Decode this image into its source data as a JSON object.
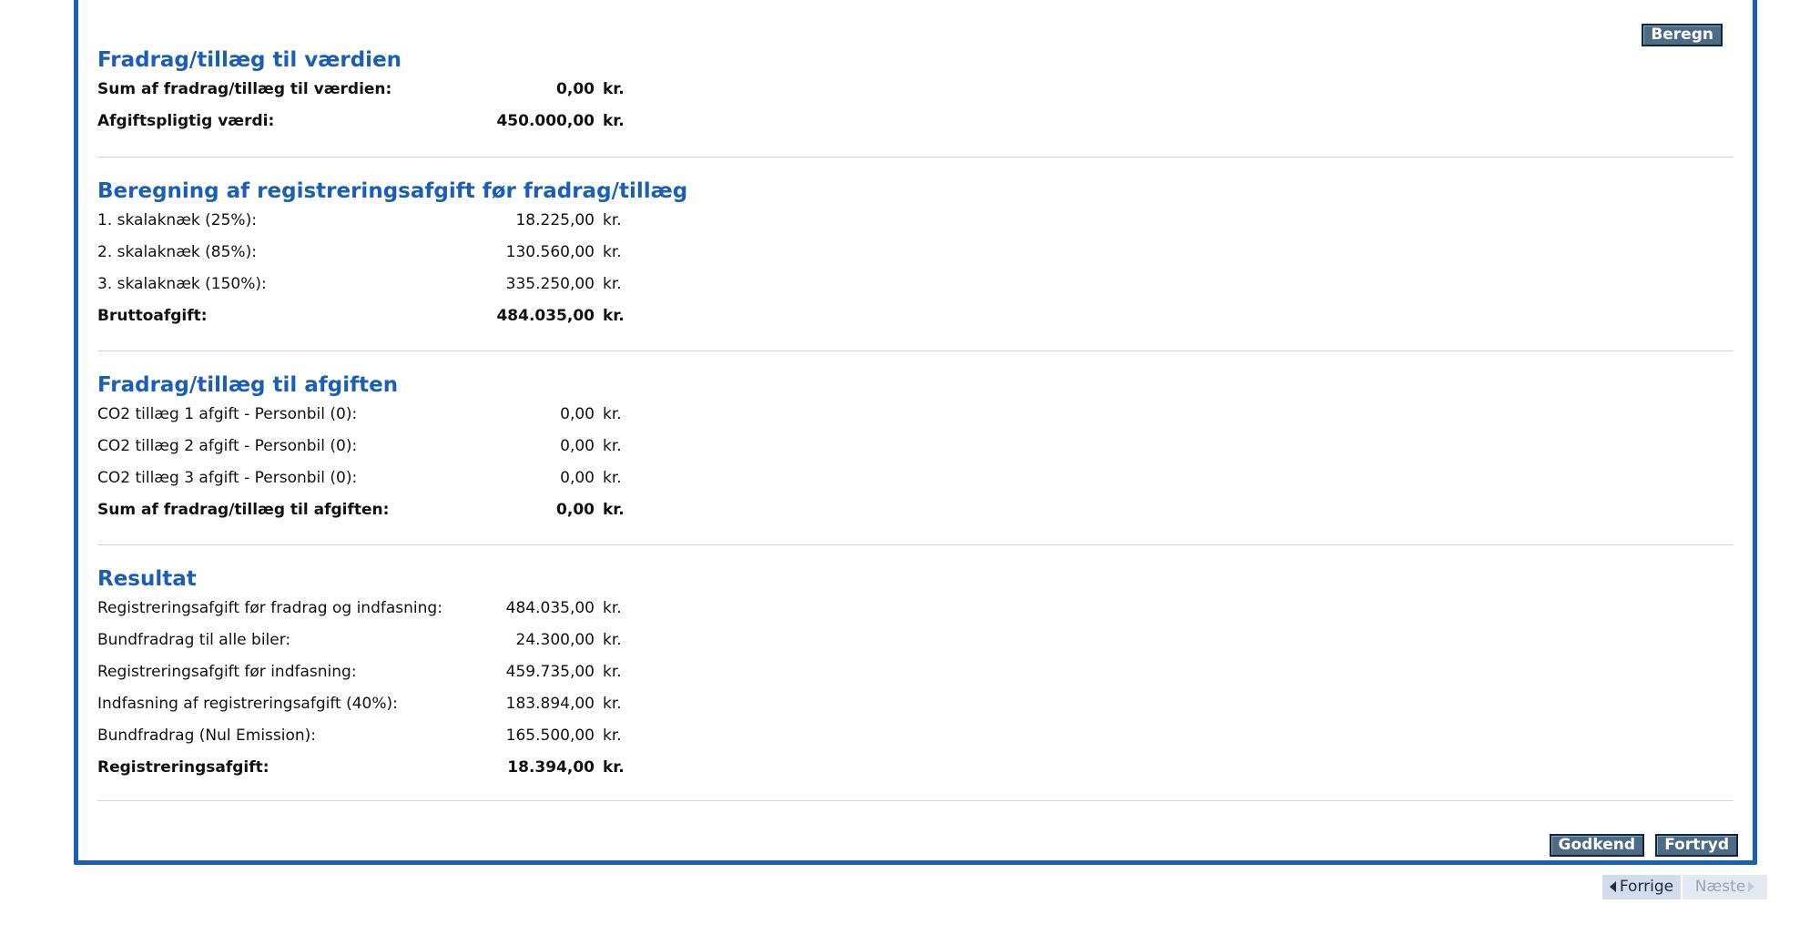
{
  "colors": {
    "accent": "#1a5fb4",
    "button_bg": "#4e6b85",
    "divider": "#d4d4d4"
  },
  "buttons": {
    "beregn": "Beregn",
    "godkend": "Godkend",
    "fortryd": "Fortryd"
  },
  "pager": {
    "prev": "Forrige",
    "next": "Næste",
    "prev_icon": "triangle-left-icon",
    "next_icon": "triangle-right-icon"
  },
  "sections": [
    {
      "title": "Fradrag/tillæg til værdien",
      "rows": [
        {
          "label": "Sum af fradrag/tillæg til værdien:",
          "value": "0,00",
          "unit": "kr.",
          "bold": true
        },
        {
          "label": "Afgiftspligtig værdi:",
          "value": "450.000,00",
          "unit": "kr.",
          "bold": true
        }
      ]
    },
    {
      "title": "Beregning af registreringsafgift før fradrag/tillæg",
      "rows": [
        {
          "label": "1. skalaknæk (25%):",
          "value": "18.225,00",
          "unit": "kr.",
          "bold": false
        },
        {
          "label": "2. skalaknæk (85%):",
          "value": "130.560,00",
          "unit": "kr.",
          "bold": false
        },
        {
          "label": "3. skalaknæk (150%):",
          "value": "335.250,00",
          "unit": "kr.",
          "bold": false
        },
        {
          "label": "Bruttoafgift:",
          "value": "484.035,00",
          "unit": "kr.",
          "bold": true
        }
      ]
    },
    {
      "title": "Fradrag/tillæg til afgiften",
      "rows": [
        {
          "label": "CO2 tillæg 1 afgift - Personbil (0):",
          "value": "0,00",
          "unit": "kr.",
          "bold": false
        },
        {
          "label": "CO2 tillæg 2 afgift - Personbil (0):",
          "value": "0,00",
          "unit": "kr.",
          "bold": false
        },
        {
          "label": "CO2 tillæg 3 afgift - Personbil (0):",
          "value": "0,00",
          "unit": "kr.",
          "bold": false
        },
        {
          "label": "Sum af fradrag/tillæg til afgiften:",
          "value": "0,00",
          "unit": "kr.",
          "bold": true
        }
      ]
    },
    {
      "title": "Resultat",
      "rows": [
        {
          "label": "Registreringsafgift før fradrag og indfasning:",
          "value": "484.035,00",
          "unit": "kr.",
          "bold": false
        },
        {
          "label": "Bundfradrag til alle biler:",
          "value": "24.300,00",
          "unit": "kr.",
          "bold": false
        },
        {
          "label": "Registreringsafgift før indfasning:",
          "value": "459.735,00",
          "unit": "kr.",
          "bold": false
        },
        {
          "label": "Indfasning af registreringsafgift (40%):",
          "value": "183.894,00",
          "unit": "kr.",
          "bold": false
        },
        {
          "label": "Bundfradrag (Nul Emission):",
          "value": "165.500,00",
          "unit": "kr.",
          "bold": false
        },
        {
          "label": "Registreringsafgift:",
          "value": "18.394,00",
          "unit": "kr.",
          "bold": true
        }
      ]
    }
  ]
}
